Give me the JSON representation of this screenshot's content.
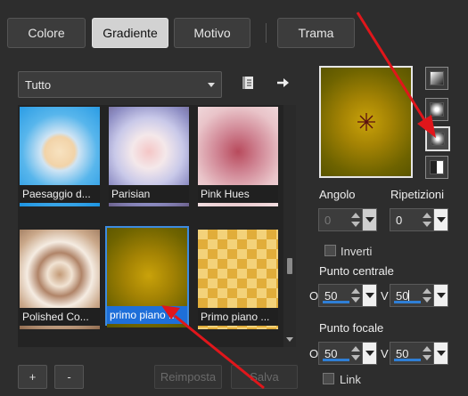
{
  "tabs": [
    {
      "label": "Colore"
    },
    {
      "label": "Gradiente"
    },
    {
      "label": "Motivo"
    },
    {
      "label": "Trama"
    }
  ],
  "library": {
    "dropdown_value": "Tutto",
    "items": [
      {
        "label": "Paesaggio d..."
      },
      {
        "label": "Parisian"
      },
      {
        "label": "Pink Hues"
      },
      {
        "label": "Polished Co..."
      },
      {
        "label": "primo piano ..."
      },
      {
        "label": "Primo piano ..."
      }
    ],
    "selected_index": 4
  },
  "buttons": {
    "add": "+",
    "remove": "-",
    "reset": "Reimposta",
    "save": "Salva"
  },
  "controls": {
    "angle_label": "Angolo",
    "angle_value": "0",
    "repeat_label": "Ripetizioni",
    "repeat_value": "0",
    "invert_label": "Inverti",
    "center_label": "Punto centrale",
    "center_h_label": "O",
    "center_h_value": "50",
    "center_v_label": "V",
    "center_v_value": "50",
    "focal_label": "Punto focale",
    "focal_h_label": "O",
    "focal_h_value": "50",
    "focal_v_label": "V",
    "focal_v_value": "50",
    "link_label": "Link"
  },
  "colors": {
    "accent": "#1e6fd9",
    "annotation_arrow": "#e0161b"
  }
}
